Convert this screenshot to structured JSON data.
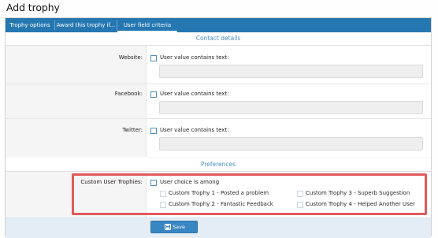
{
  "page": {
    "title": "Add trophy"
  },
  "tabs": [
    {
      "label": "Trophy options"
    },
    {
      "label": "Award this trophy if..."
    },
    {
      "label": "User field criteria",
      "active": true
    }
  ],
  "contact": {
    "heading": "Contact details",
    "fields": [
      {
        "label": "Website:",
        "option": "User value contains text:",
        "value": ""
      },
      {
        "label": "Facebook:",
        "option": "User value contains text:",
        "value": ""
      },
      {
        "label": "Twitter:",
        "option": "User value contains text:",
        "value": ""
      }
    ]
  },
  "preferences": {
    "heading": "Preferences",
    "custom_trophies": {
      "label": "Custom User Trophies:",
      "option": "User choice is among",
      "choices": [
        {
          "label": "Custom Trophy 1 - Posted a problem"
        },
        {
          "label": "Custom Trophy 3 - Superb Suggestion"
        },
        {
          "label": "Custom Trophy 2 - Fantastic Feedback"
        },
        {
          "label": "Custom Trophy 4 - Helped Another User"
        }
      ]
    }
  },
  "footer": {
    "save_label": "Save",
    "save_icon": "floppy-disk-icon"
  },
  "colors": {
    "tab_bar": "#2577b1",
    "section_heading": "#4a8fc2",
    "highlight_border": "#e05a5c",
    "save_button": "#3a86c3",
    "footer_bg": "#e4edf5"
  }
}
